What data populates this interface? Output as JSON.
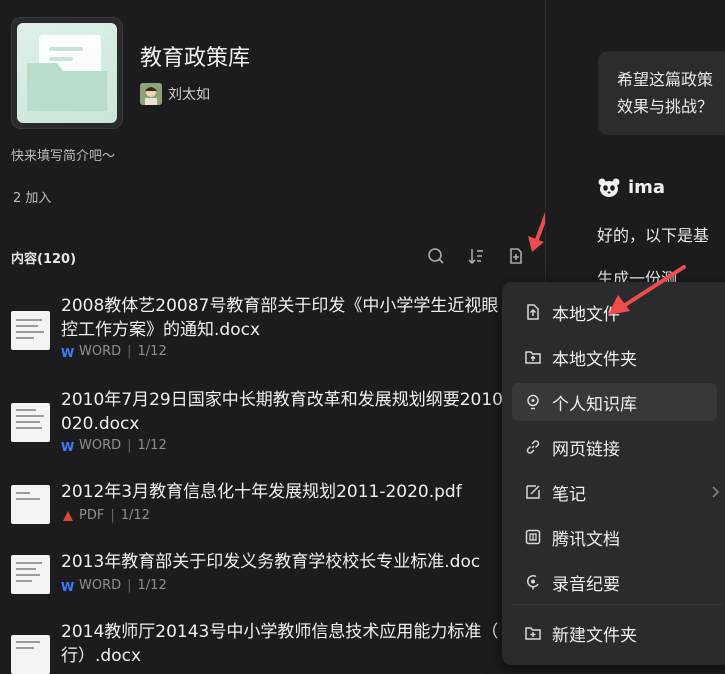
{
  "knowledge_base": {
    "title": "教育政策库",
    "owner": "刘太如",
    "intro": "快来填写简介吧～",
    "joined": "2 加入"
  },
  "content": {
    "header": "内容(120)",
    "files": [
      {
        "line1": "2008教体艺20087号教育部关于印发《中小学学生近视眼",
        "line2": "控工作方案》的通知.docx",
        "type": "WORD",
        "pages": "1/12"
      },
      {
        "line1": "2010年7月29日国家中长期教育改革和发展规划纲要2010",
        "line2": "020.docx",
        "type": "WORD",
        "pages": "1/12"
      },
      {
        "line1": "2012年3月教育信息化十年发展规划2011-2020.pdf",
        "line2": "",
        "type": "PDF",
        "pages": "1/12"
      },
      {
        "line1": "2013年教育部关于印发义务教育学校校长专业标准.doc",
        "line2": "",
        "type": "WORD",
        "pages": "1/12"
      },
      {
        "line1": "2014教师厅20143号中小学教师信息技术应用能力标准（",
        "line2": "行）.docx",
        "type": "",
        "pages": ""
      }
    ]
  },
  "menu": {
    "items": [
      {
        "label": "本地文件",
        "icon": "upload-file-icon"
      },
      {
        "label": "本地文件夹",
        "icon": "upload-folder-icon"
      },
      {
        "label": "个人知识库",
        "icon": "bulb-icon"
      },
      {
        "label": "网页链接",
        "icon": "link-icon"
      },
      {
        "label": "笔记",
        "icon": "note-icon"
      },
      {
        "label": "腾讯文档",
        "icon": "tencent-doc-icon"
      },
      {
        "label": "录音纪要",
        "icon": "record-icon"
      },
      {
        "label": "新建文件夹",
        "icon": "new-folder-icon"
      }
    ]
  },
  "chat": {
    "question_line1": "希望这篇政策",
    "question_line2": "效果与挑战？",
    "assistant_name": "ima",
    "reply_line1": "好的，以下是基",
    "reply_line2": "生成一份测"
  },
  "colors": {
    "accent_arrow": "#ee4d4d",
    "word_blue": "#3b7cff",
    "pdf_red": "#e2463b"
  }
}
